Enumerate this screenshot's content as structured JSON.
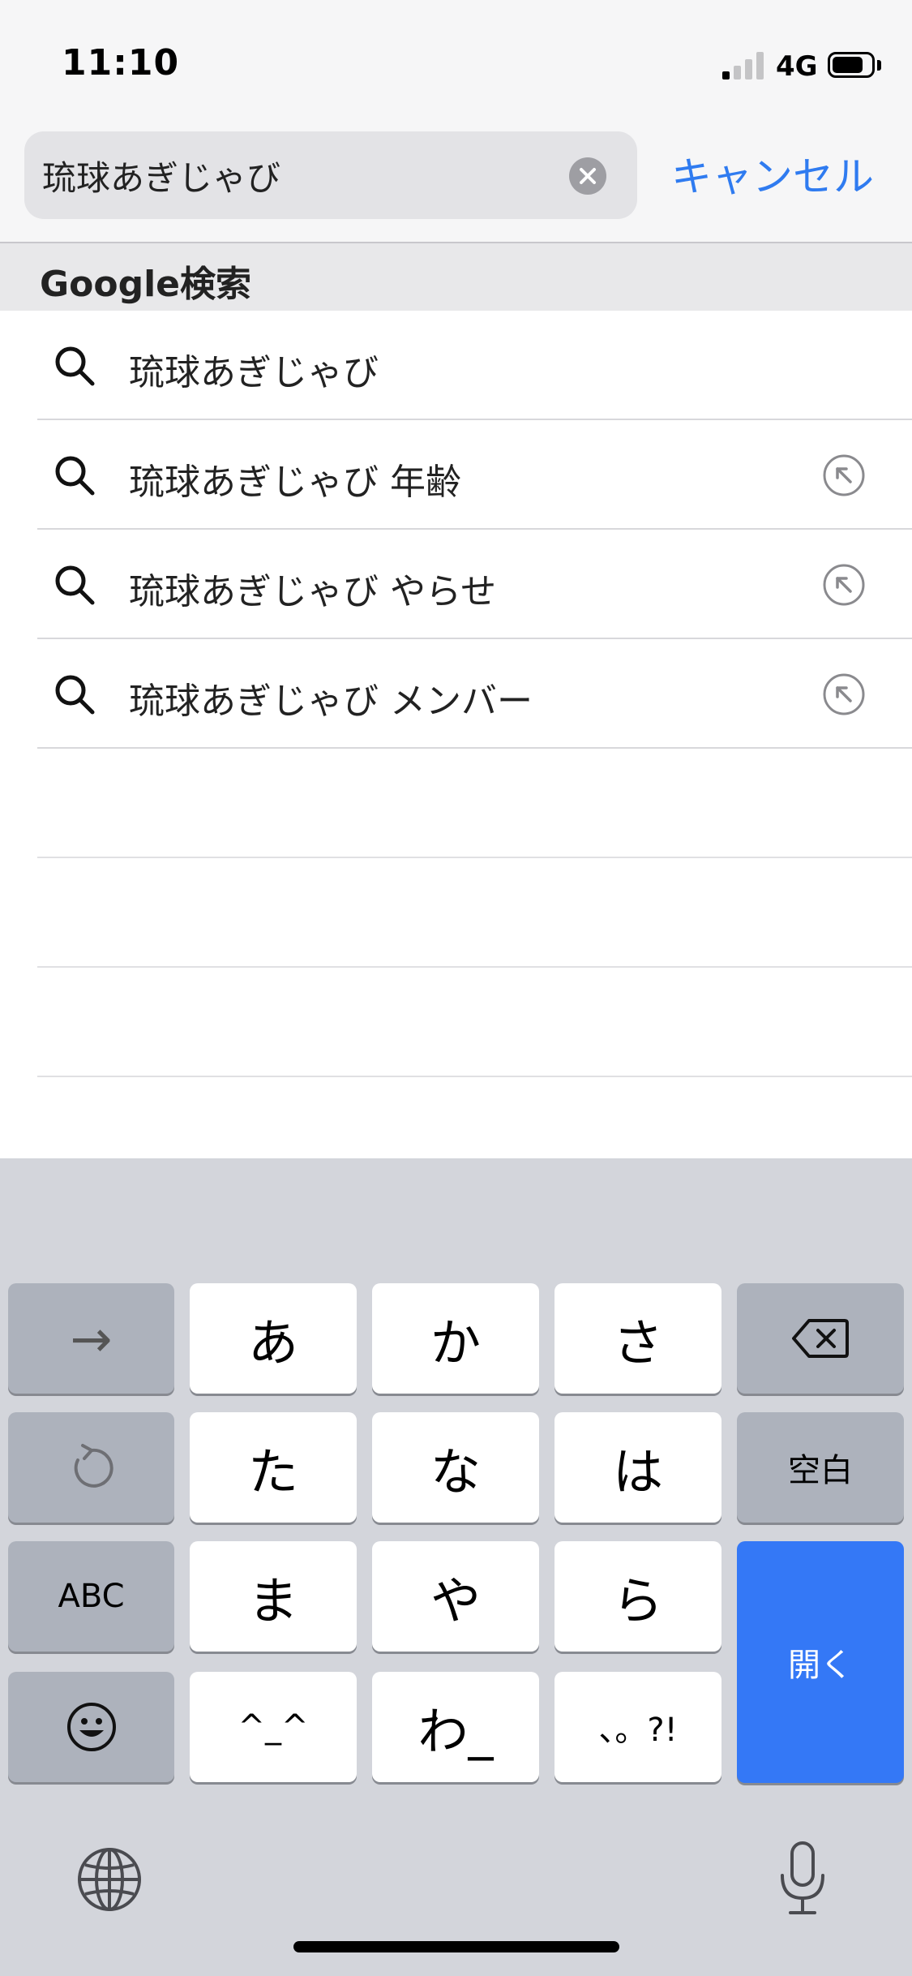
{
  "status_bar": {
    "time": "11:10",
    "network": "4G",
    "signal_bars_active": 1,
    "signal_bars_total": 4,
    "battery_level": 0.8
  },
  "search": {
    "query": "琉球あぎじゃび",
    "cancel_label": "キャンセル"
  },
  "section": {
    "title": "Google検索"
  },
  "suggestions": [
    {
      "text": "琉球あぎじゃび",
      "has_fill_button": false
    },
    {
      "text": "琉球あぎじゃび 年齢",
      "has_fill_button": true
    },
    {
      "text": "琉球あぎじゃび やらせ",
      "has_fill_button": true
    },
    {
      "text": "琉球あぎじゃび メンバー",
      "has_fill_button": true
    }
  ],
  "keyboard": {
    "row1": {
      "arrow": "→",
      "k1": "あ",
      "k2": "か",
      "k3": "さ",
      "delete_icon": "delete-icon"
    },
    "row2": {
      "undo_icon": "undo-icon",
      "k1": "た",
      "k2": "な",
      "k3": "は",
      "space": "空白"
    },
    "row3": {
      "abc": "ABC",
      "k1": "ま",
      "k2": "や",
      "k3": "ら"
    },
    "row4": {
      "emoji_icon": "emoji-icon",
      "k1": "^_^",
      "k2": "わ_",
      "k3": "、。?!"
    },
    "open_label": "開く",
    "globe_icon": "globe-icon",
    "mic_icon": "microphone-icon"
  },
  "colors": {
    "accent": "#2f7bf0",
    "return_key": "#3478f6",
    "keyboard_bg": "#d3d5db"
  }
}
